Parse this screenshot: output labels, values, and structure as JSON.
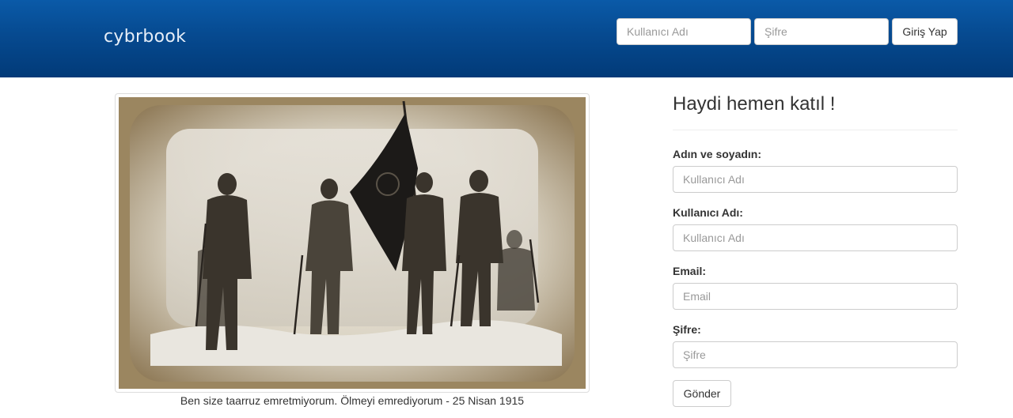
{
  "navbar": {
    "brand": "cybrbook",
    "username_placeholder": "Kullanıcı Adı",
    "password_placeholder": "Şifre",
    "login_label": "Giriş Yap"
  },
  "main": {
    "photo_caption": "Ben size taarruz emretmiyorum. Ölmeyi emrediyorum - 25 Nisan 1915"
  },
  "signup": {
    "title": "Haydi hemen katıl !",
    "fields": [
      {
        "label": "Adın ve soyadın:",
        "placeholder": "Kullanıcı Adı"
      },
      {
        "label": "Kullanıcı Adı:",
        "placeholder": "Kullanıcı Adı"
      },
      {
        "label": "Email:",
        "placeholder": "Email"
      },
      {
        "label": "Şifre:",
        "placeholder": "Şifre"
      }
    ],
    "submit_label": "Gönder"
  },
  "colors": {
    "navbar_top": "#0a5aa8",
    "navbar_bottom": "#023a78"
  }
}
